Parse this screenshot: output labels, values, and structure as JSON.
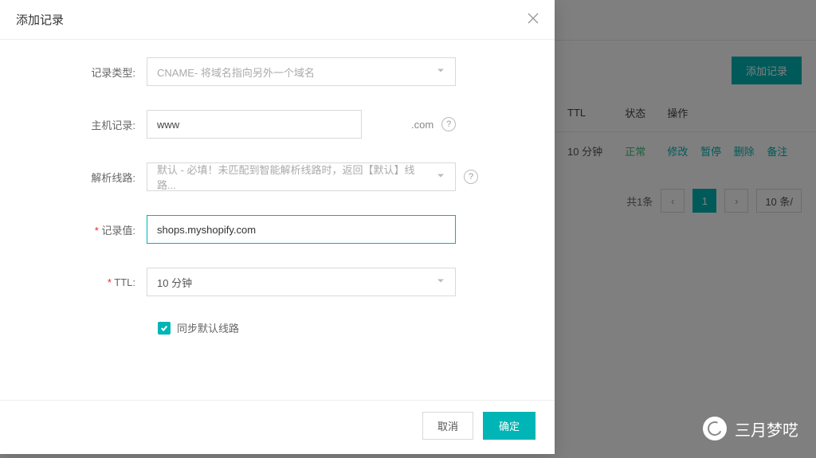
{
  "bg": {
    "btn_add": "添加记录",
    "cols": {
      "ttl": "TTL",
      "status": "状态",
      "ops": "操作"
    },
    "row": {
      "ttl": "10 分钟",
      "status": "正常",
      "ops": {
        "edit": "修改",
        "pause": "暂停",
        "delete": "删除",
        "remark": "备注"
      }
    },
    "pager": {
      "total": "共1条",
      "page": "1",
      "size": "10 条/"
    }
  },
  "modal": {
    "title": "添加记录",
    "labels": {
      "type": "记录类型:",
      "host": "主机记录:",
      "line": "解析线路:",
      "value": "记录值:",
      "ttl": "TTL:"
    },
    "fields": {
      "type_value": "CNAME- 将域名指向另外一个域名",
      "host_value": "www",
      "host_suffix": ".com",
      "line_value": "默认 - 必填！未匹配到智能解析线路时，返回【默认】线路...",
      "record_value": "shops.myshopify.com",
      "ttl_value": "10 分钟"
    },
    "checkbox_label": "同步默认线路",
    "cancel": "取消",
    "confirm": "确定"
  },
  "watermark": "三月梦呓"
}
